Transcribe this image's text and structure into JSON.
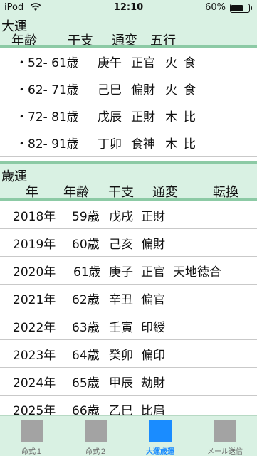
{
  "status": {
    "carrier": "iPod",
    "time": "12:10",
    "battery": "60%",
    "battery_level": 0.6
  },
  "daiun": {
    "title": "大運",
    "headers": [
      "年齢",
      "干支",
      "通変",
      "五行"
    ],
    "rows": [
      {
        "bullet": "・",
        "age": "52- 61歳",
        "kanshi": "庚午",
        "tsuhen": "正官",
        "gogyo": "火",
        "extra": "食"
      },
      {
        "bullet": "・",
        "age": "62- 71歳",
        "kanshi": "己巳",
        "tsuhen": "偏財",
        "gogyo": "火",
        "extra": "食"
      },
      {
        "bullet": "・",
        "age": "72- 81歳",
        "kanshi": "戊辰",
        "tsuhen": "正財",
        "gogyo": "木",
        "extra": "比"
      },
      {
        "bullet": "・",
        "age": "82- 91歳",
        "kanshi": "丁卯",
        "tsuhen": "食神",
        "gogyo": "木",
        "extra": "比"
      }
    ]
  },
  "saiun": {
    "title": "歳運",
    "headers": [
      "年",
      "年齢",
      "干支",
      "通変",
      "転換"
    ],
    "rows": [
      {
        "year": "2018年",
        "age": "59歳",
        "kanshi": "戊戌",
        "tsuhen": "正財",
        "tenkan": ""
      },
      {
        "year": "2019年",
        "age": "60歳",
        "kanshi": "己亥",
        "tsuhen": "偏財",
        "tenkan": ""
      },
      {
        "year": "2020年",
        "age": "61歳",
        "kanshi": "庚子",
        "tsuhen": "正官",
        "tenkan": "天地徳合"
      },
      {
        "year": "2021年",
        "age": "62歳",
        "kanshi": "辛丑",
        "tsuhen": "偏官",
        "tenkan": ""
      },
      {
        "year": "2022年",
        "age": "63歳",
        "kanshi": "壬寅",
        "tsuhen": "印綬",
        "tenkan": ""
      },
      {
        "year": "2023年",
        "age": "64歳",
        "kanshi": "癸卯",
        "tsuhen": "偏印",
        "tenkan": ""
      },
      {
        "year": "2024年",
        "age": "65歳",
        "kanshi": "甲辰",
        "tsuhen": "劫財",
        "tenkan": ""
      },
      {
        "year": "2025年",
        "age": "66歳",
        "kanshi": "乙巳",
        "tsuhen": "比肩",
        "tenkan": ""
      }
    ]
  },
  "tabs": [
    {
      "label": "命式１",
      "active": false
    },
    {
      "label": "命式２",
      "active": false
    },
    {
      "label": "大運歳運",
      "active": true
    },
    {
      "label": "メール送信",
      "active": false
    }
  ],
  "colors": {
    "header_bg": "#d9f1e3",
    "header_border": "#8ccaa5",
    "active_tab": "#1a8cff",
    "inactive_tab": "#a3a3a3"
  }
}
